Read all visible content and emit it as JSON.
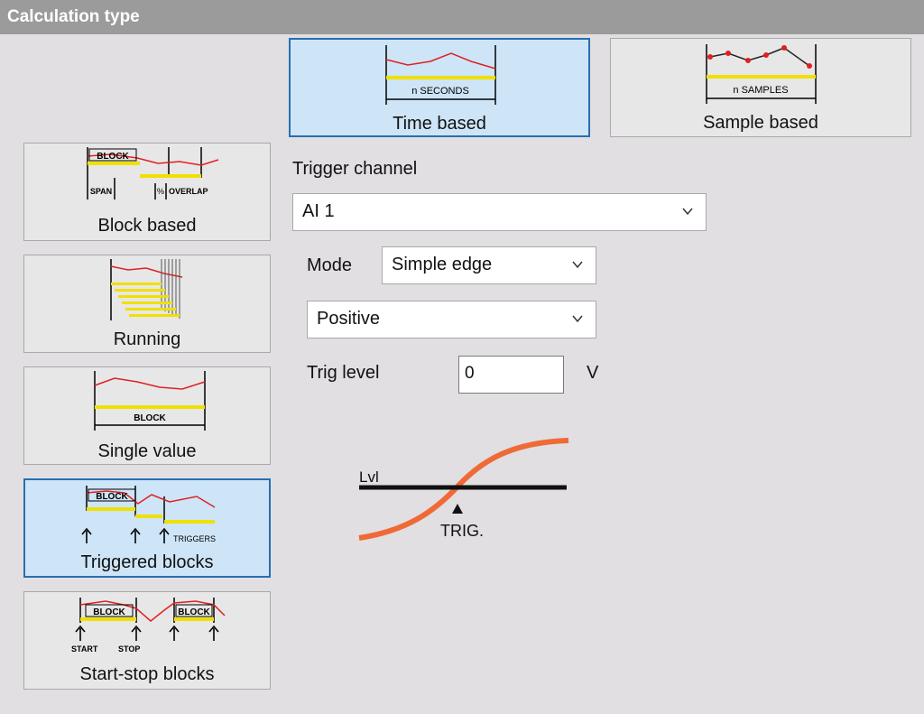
{
  "title": "Calculation type",
  "top_buttons": {
    "time_based": {
      "label": "Time based",
      "icon_text": "n SECONDS"
    },
    "sample_based": {
      "label": "Sample based",
      "icon_text": "n SAMPLES"
    }
  },
  "left_buttons": {
    "block_based": {
      "label": "Block based",
      "icon_block": "BLOCK",
      "icon_span": "SPAN",
      "icon_pct": "%",
      "icon_overlap": "OVERLAP"
    },
    "running": {
      "label": "Running"
    },
    "single_value": {
      "label": "Single value",
      "icon_block": "BLOCK"
    },
    "triggered_blocks": {
      "label": "Triggered blocks",
      "icon_block": "BLOCK",
      "icon_triggers": "TRIGGERS"
    },
    "start_stop_blocks": {
      "label": "Start-stop blocks",
      "icon_block1": "BLOCK",
      "icon_block2": "BLOCK",
      "icon_start": "START",
      "icon_stop": "STOP"
    }
  },
  "trigger": {
    "channel_label": "Trigger channel",
    "channel_value": "AI 1",
    "mode_label": "Mode",
    "mode_value": "Simple edge",
    "edge_value": "Positive",
    "level_label": "Trig level",
    "level_value": "0",
    "level_unit": "V"
  },
  "diagram": {
    "level_label": "Lvl",
    "trig_label": "TRIG."
  },
  "colors": {
    "selected_bg": "#cde5f7",
    "selected_border": "#2a6db1",
    "curve": "#ef6a36",
    "signal": "#e02020",
    "highlight": "#f0e000"
  }
}
